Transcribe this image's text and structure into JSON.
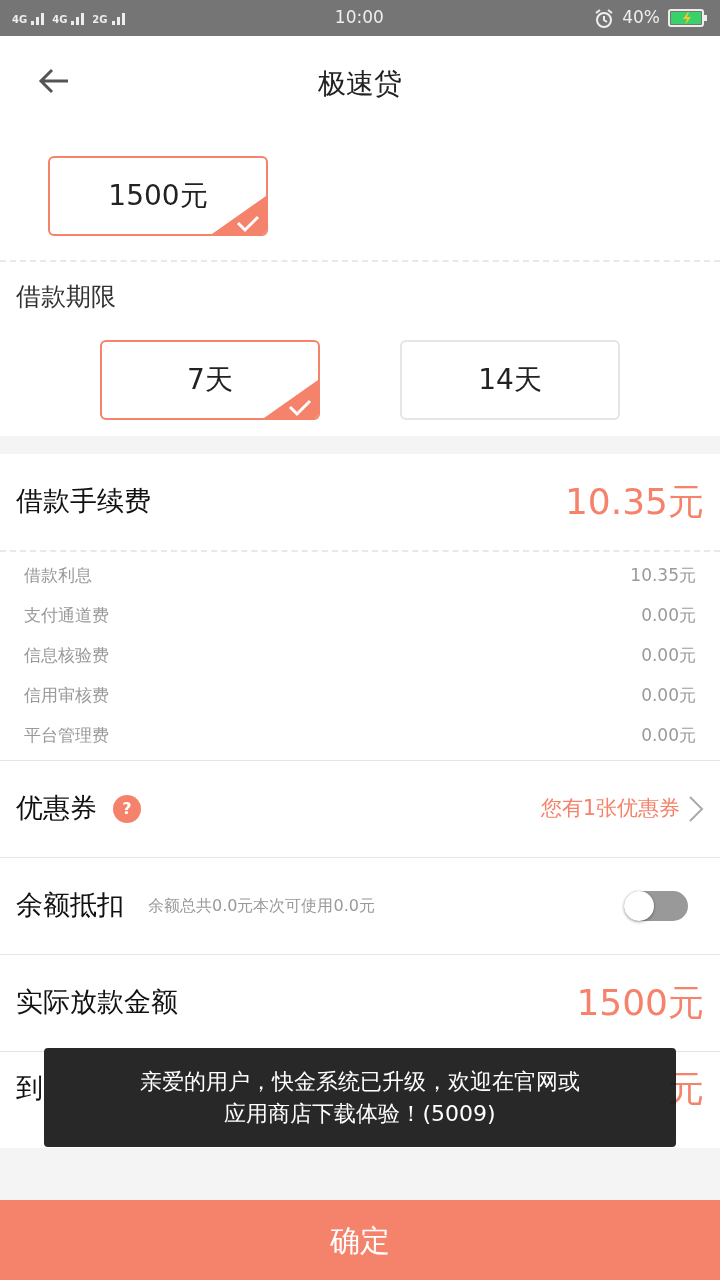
{
  "status_bar": {
    "networks": [
      "4G",
      "4G",
      "2G"
    ],
    "time": "10:00",
    "battery": "40%",
    "charging": true
  },
  "header": {
    "title": "极速贷"
  },
  "amount_options": [
    {
      "label": "1500元",
      "selected": true
    }
  ],
  "term": {
    "title": "借款期限",
    "options": [
      {
        "label": "7天",
        "selected": true
      },
      {
        "label": "14天",
        "selected": false
      }
    ]
  },
  "fee": {
    "label": "借款手续费",
    "value": "10.35元",
    "details": [
      {
        "label": "借款利息",
        "value": "10.35元"
      },
      {
        "label": "支付通道费",
        "value": "0.00元"
      },
      {
        "label": "信息核验费",
        "value": "0.00元"
      },
      {
        "label": "信用审核费",
        "value": "0.00元"
      },
      {
        "label": "平台管理费",
        "value": "0.00元"
      }
    ]
  },
  "coupon": {
    "label": "优惠券",
    "help": "?",
    "value": "您有1张优惠券"
  },
  "balance": {
    "label": "余额抵扣",
    "note": "余额总共0.0元本次可使用0.0元",
    "on": false
  },
  "summary": [
    {
      "label": "实际放款金额",
      "value": "1500元"
    },
    {
      "label": "到",
      "value": "元"
    }
  ],
  "toast": {
    "lines": [
      "亲爱的用户，快金系统已升级，欢迎在官网或",
      "应用商店下载体验！(5009)"
    ]
  },
  "confirm_button": "确定"
}
